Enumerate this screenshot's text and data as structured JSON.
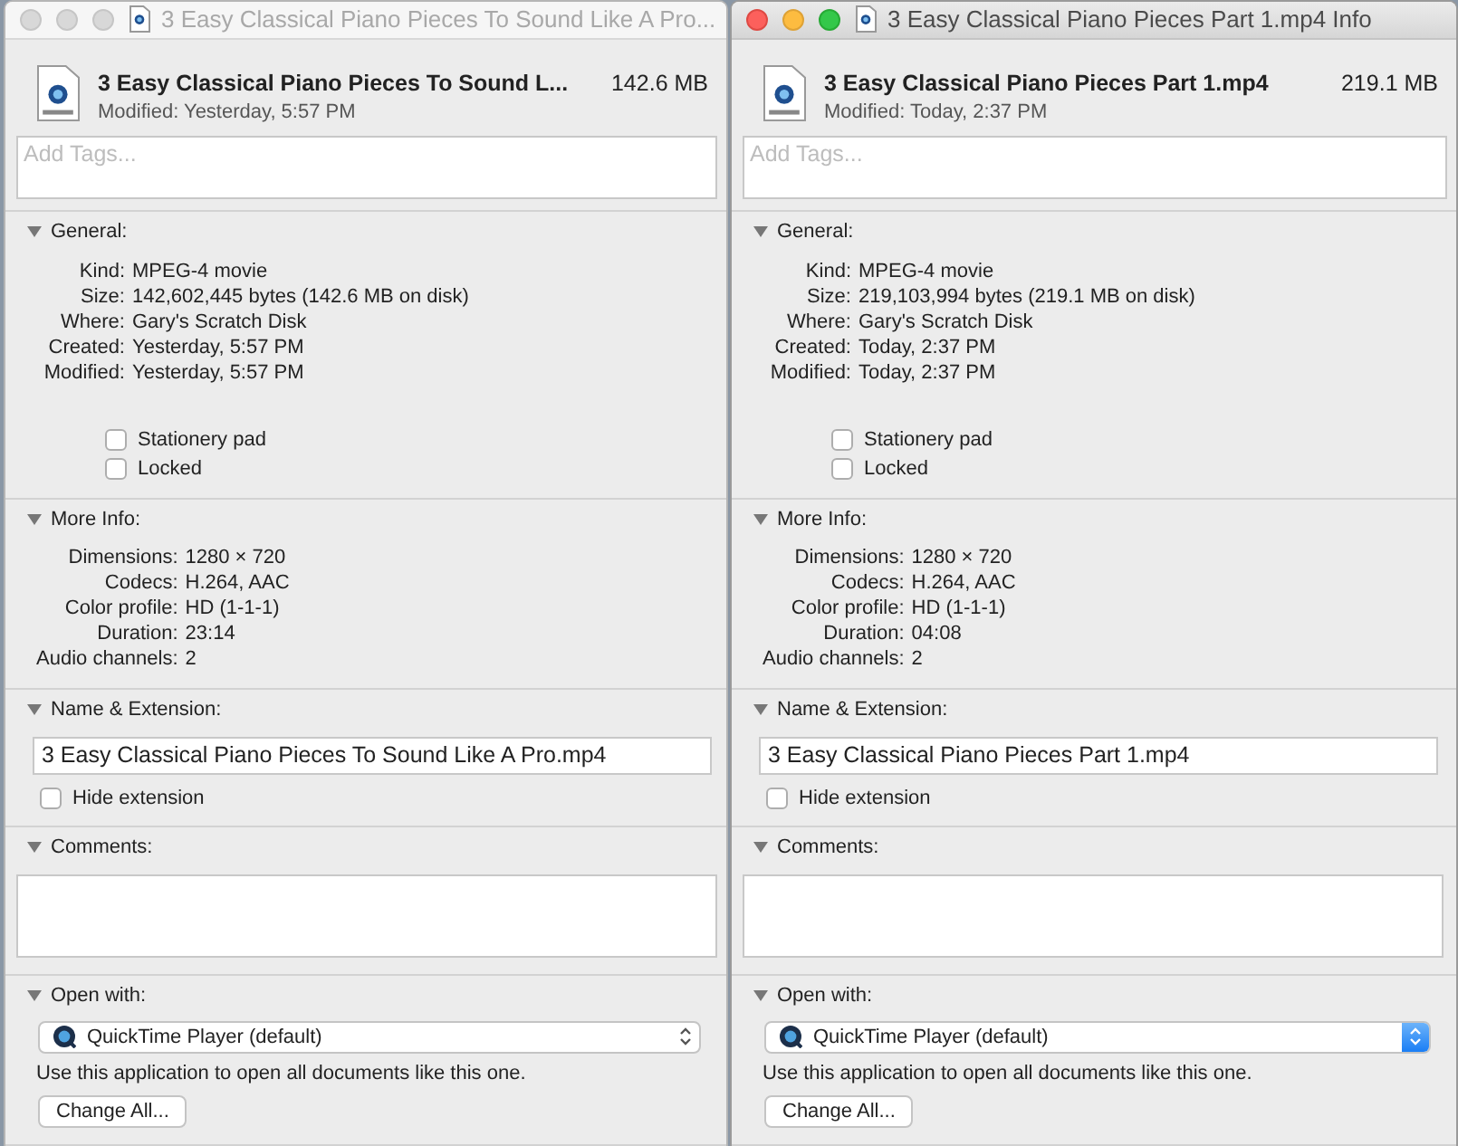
{
  "windows": [
    {
      "title": "3 Easy Classical Piano Pieces To Sound Like A Pro...",
      "active": false,
      "file_name": "3 Easy Classical Piano Pieces To Sound L...",
      "file_size": "142.6 MB",
      "modified": "Modified: Yesterday, 5:57 PM",
      "tags": {
        "placeholder": "Add Tags..."
      },
      "sections": [
        {
          "kind": "general",
          "title": "General:",
          "expanded": true,
          "rows": [
            {
              "label": "Kind:",
              "value": "MPEG-4 movie"
            },
            {
              "label": "Size:",
              "value": "142,602,445 bytes (142.6 MB on disk)"
            },
            {
              "label": "Where:",
              "value": "Gary's Scratch Disk"
            },
            {
              "label": "Created:",
              "value": "Yesterday, 5:57 PM"
            },
            {
              "label": "Modified:",
              "value": "Yesterday, 5:57 PM"
            }
          ],
          "checkboxes": [
            {
              "label": "Stationery pad",
              "checked": false
            },
            {
              "label": "Locked",
              "checked": false
            }
          ]
        },
        {
          "kind": "details",
          "title": "More Info:",
          "expanded": true,
          "rows": [
            {
              "label": "Dimensions:",
              "value": "1280 × 720"
            },
            {
              "label": "Codecs:",
              "value": "H.264, AAC"
            },
            {
              "label": "Color profile:",
              "value": "HD (1-1-1)"
            },
            {
              "label": "Duration:",
              "value": "23:14"
            },
            {
              "label": "Audio channels:",
              "value": "2"
            }
          ]
        },
        {
          "kind": "name",
          "title": "Name & Extension:",
          "expanded": true,
          "value": "3 Easy Classical Piano Pieces To Sound Like A Pro.mp4",
          "checkboxes": [
            {
              "label": "Hide extension",
              "checked": false
            }
          ]
        },
        {
          "kind": "comments",
          "title": "Comments:",
          "expanded": true
        },
        {
          "kind": "open_with",
          "title": "Open with:",
          "expanded": true,
          "app": "QuickTime Player (default)",
          "note": "Use this application to open all documents like this one.",
          "button": "Change All..."
        }
      ]
    },
    {
      "title": "3 Easy Classical Piano Pieces Part 1.mp4 Info",
      "active": true,
      "file_name": "3 Easy Classical Piano Pieces Part 1.mp4",
      "file_size": "219.1 MB",
      "modified": "Modified: Today, 2:37 PM",
      "tags": {
        "placeholder": "Add Tags..."
      },
      "sections": [
        {
          "kind": "general",
          "title": "General:",
          "expanded": true,
          "rows": [
            {
              "label": "Kind:",
              "value": "MPEG-4 movie"
            },
            {
              "label": "Size:",
              "value": "219,103,994 bytes (219.1 MB on disk)"
            },
            {
              "label": "Where:",
              "value": "Gary's Scratch Disk"
            },
            {
              "label": "Created:",
              "value": "Today, 2:37 PM"
            },
            {
              "label": "Modified:",
              "value": "Today, 2:37 PM"
            }
          ],
          "checkboxes": [
            {
              "label": "Stationery pad",
              "checked": false
            },
            {
              "label": "Locked",
              "checked": false
            }
          ]
        },
        {
          "kind": "details",
          "title": "More Info:",
          "expanded": true,
          "rows": [
            {
              "label": "Dimensions:",
              "value": "1280 × 720"
            },
            {
              "label": "Codecs:",
              "value": "H.264, AAC"
            },
            {
              "label": "Color profile:",
              "value": "HD (1-1-1)"
            },
            {
              "label": "Duration:",
              "value": "04:08"
            },
            {
              "label": "Audio channels:",
              "value": "2"
            }
          ]
        },
        {
          "kind": "name",
          "title": "Name & Extension:",
          "expanded": true,
          "value": "3 Easy Classical Piano Pieces Part 1.mp4",
          "checkboxes": [
            {
              "label": "Hide extension",
              "checked": false
            }
          ]
        },
        {
          "kind": "comments",
          "title": "Comments:",
          "expanded": true
        },
        {
          "kind": "open_with",
          "title": "Open with:",
          "expanded": true,
          "app": "QuickTime Player (default)",
          "note": "Use this application to open all documents like this one.",
          "button": "Change All..."
        }
      ]
    }
  ]
}
